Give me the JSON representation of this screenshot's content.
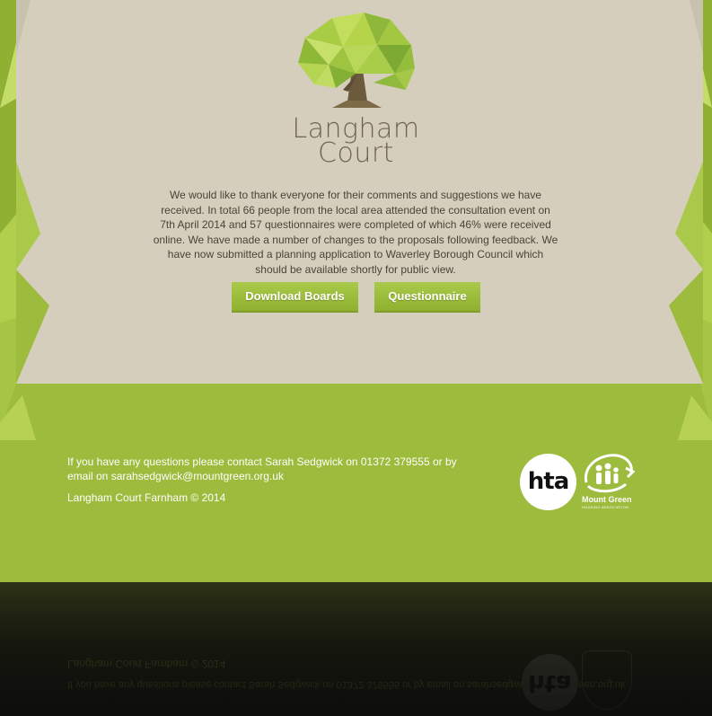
{
  "brand": {
    "name_line1": "Langham",
    "name_line2": "Court"
  },
  "intro": {
    "text": "We would like to thank everyone for their comments and suggestions we have received. In total 66 people from the local area attended the consultation event on 7th April 2014 and 57 questionnaires were completed of which 46% were received online. We have made a number of changes to the proposals following feedback. We have now submitted a planning application to Waverley Borough Council which should be available shortly for public view."
  },
  "buttons": {
    "download_label": "Download Boards",
    "questionnaire_label": "Questionnaire"
  },
  "footer": {
    "contact_text": "If you have any questions please contact Sarah Sedgwick on 01372 379555 or by email on sarahsedgwick@mountgreen.org.uk",
    "copyright": "Langham Court Farnham © 2014",
    "hta_logo_text": "hta",
    "mountgreen_name": "Mount Green",
    "mountgreen_sub": "HOUSING ASSOCIATION"
  },
  "colors": {
    "green": "#9dbb3c",
    "beige": "#d5cebd",
    "text_brown": "#4a4338",
    "tree_light": "#b5d44a",
    "tree_dark": "#6f9a2c"
  },
  "icons": {
    "tree_logo": "low-poly-tree-icon",
    "mountgreen_logo": "mount-green-people-icon"
  }
}
